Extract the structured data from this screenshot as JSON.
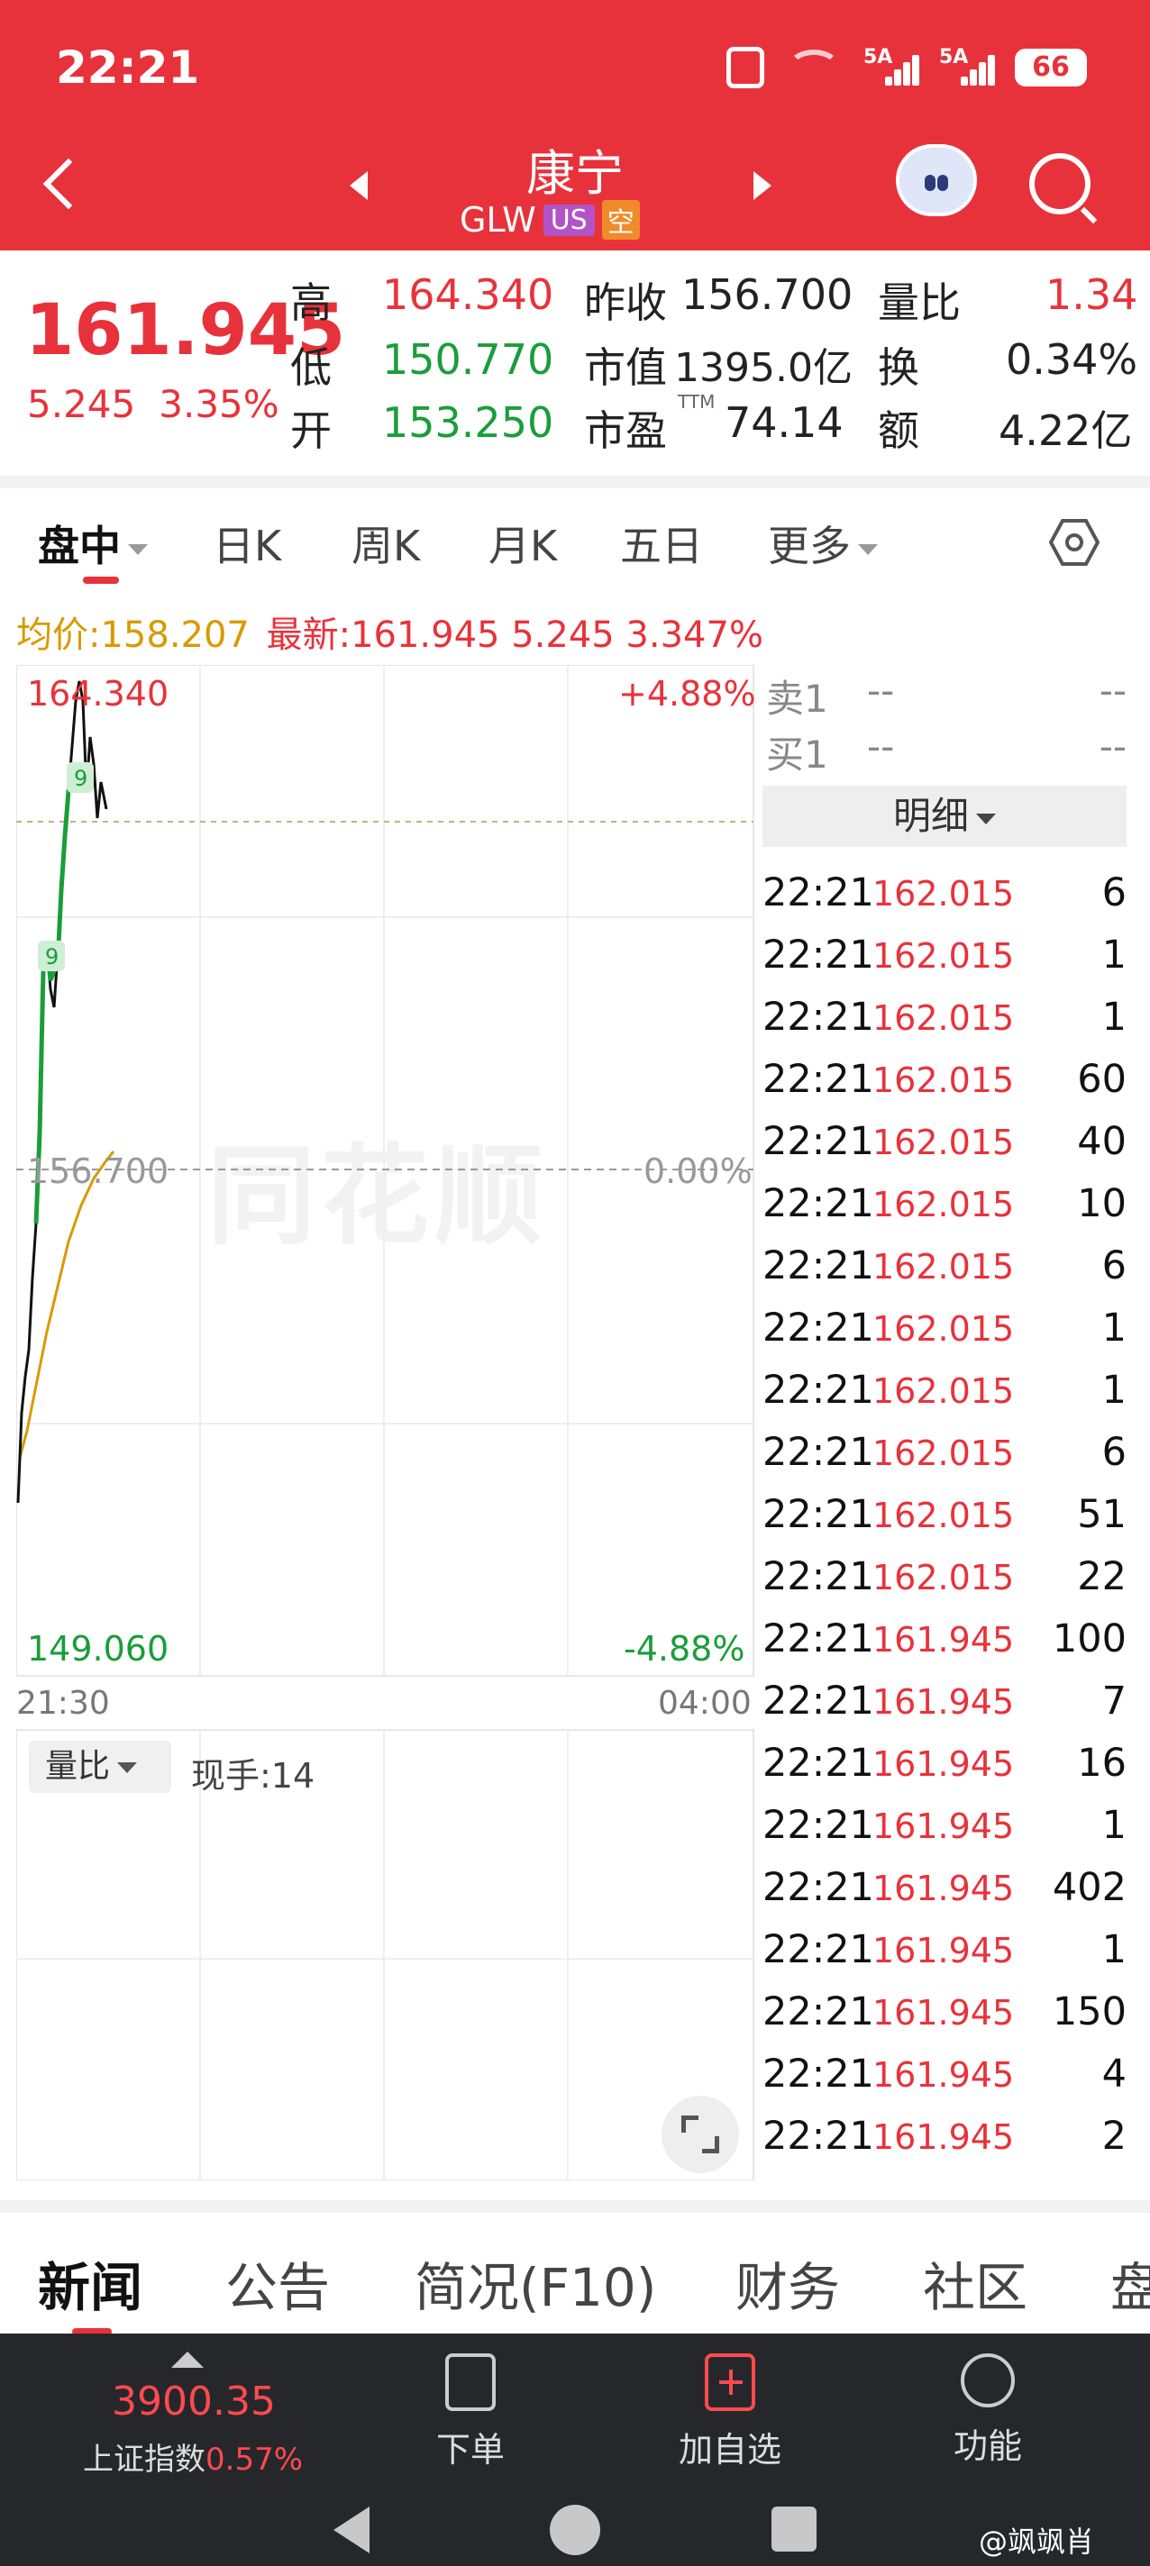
{
  "status_bar": {
    "time": "22:21",
    "battery": "66",
    "net1": "5A",
    "net2": "5A"
  },
  "header": {
    "stock_name": "康宁",
    "ticker": "GLW",
    "badge_us": "US",
    "badge_short": "空"
  },
  "quote": {
    "price": "161.945",
    "change": "5.245",
    "change_pct": "3.35%",
    "high_label": "高",
    "high": "164.340",
    "low_label": "低",
    "low": "150.770",
    "open_label": "开",
    "open": "153.250",
    "prev_close_label": "昨收",
    "prev_close": "156.700",
    "mcap_label": "市值",
    "mcap": "1395.0亿",
    "pe_label": "市盈",
    "pe_sup": "TTM",
    "pe": "74.14",
    "vol_ratio_label": "量比",
    "vol_ratio": "1.34",
    "turnover_label": "换",
    "turnover": "0.34%",
    "amount_label": "额",
    "amount": "4.22亿"
  },
  "chart_tabs": [
    "盘中",
    "日K",
    "周K",
    "月K",
    "五日",
    "更多"
  ],
  "avg_line": {
    "avg": "均价:158.207",
    "latest": "最新:161.945 5.245 3.347%"
  },
  "chart": {
    "y_top": "164.340",
    "y_mid": "156.700",
    "y_bot": "149.060",
    "pct_top": "+4.88%",
    "pct_mid": "0.00%",
    "pct_bot": "-4.88%",
    "t_start": "21:30",
    "t_end": "04:00",
    "marker": "9",
    "watermark": "同花顺"
  },
  "volume": {
    "chip": "量比",
    "hand": "现手:14"
  },
  "order_book": [
    {
      "label": "卖1",
      "price": "--",
      "vol": "--"
    },
    {
      "label": "买1",
      "price": "--",
      "vol": "--"
    }
  ],
  "detail_label": "明细",
  "trades": [
    {
      "t": "22:21",
      "p": "162.015",
      "v": "6"
    },
    {
      "t": "22:21",
      "p": "162.015",
      "v": "1"
    },
    {
      "t": "22:21",
      "p": "162.015",
      "v": "1"
    },
    {
      "t": "22:21",
      "p": "162.015",
      "v": "60"
    },
    {
      "t": "22:21",
      "p": "162.015",
      "v": "40"
    },
    {
      "t": "22:21",
      "p": "162.015",
      "v": "10"
    },
    {
      "t": "22:21",
      "p": "162.015",
      "v": "6"
    },
    {
      "t": "22:21",
      "p": "162.015",
      "v": "1"
    },
    {
      "t": "22:21",
      "p": "162.015",
      "v": "1"
    },
    {
      "t": "22:21",
      "p": "162.015",
      "v": "6"
    },
    {
      "t": "22:21",
      "p": "162.015",
      "v": "51"
    },
    {
      "t": "22:21",
      "p": "162.015",
      "v": "22"
    },
    {
      "t": "22:21",
      "p": "161.945",
      "v": "100"
    },
    {
      "t": "22:21",
      "p": "161.945",
      "v": "7"
    },
    {
      "t": "22:21",
      "p": "161.945",
      "v": "16"
    },
    {
      "t": "22:21",
      "p": "161.945",
      "v": "1"
    },
    {
      "t": "22:21",
      "p": "161.945",
      "v": "402"
    },
    {
      "t": "22:21",
      "p": "161.945",
      "v": "1"
    },
    {
      "t": "22:21",
      "p": "161.945",
      "v": "150"
    },
    {
      "t": "22:21",
      "p": "161.945",
      "v": "4"
    },
    {
      "t": "22:21",
      "p": "161.945",
      "v": "2"
    }
  ],
  "bottom_tabs": [
    "新闻",
    "公告",
    "简况(F10)",
    "财务",
    "社区",
    "盘"
  ],
  "dock": {
    "index_value": "3900.35",
    "index_name": "上证指数",
    "index_pct": "0.57%",
    "order": "下单",
    "add_watch": "加自选",
    "functions": "功能"
  },
  "watermark_user": "@飒飒肖",
  "colors": {
    "brand": "#e8323b",
    "up": "#e8323b",
    "down": "#1a9d3a",
    "avg": "#d99a00"
  }
}
